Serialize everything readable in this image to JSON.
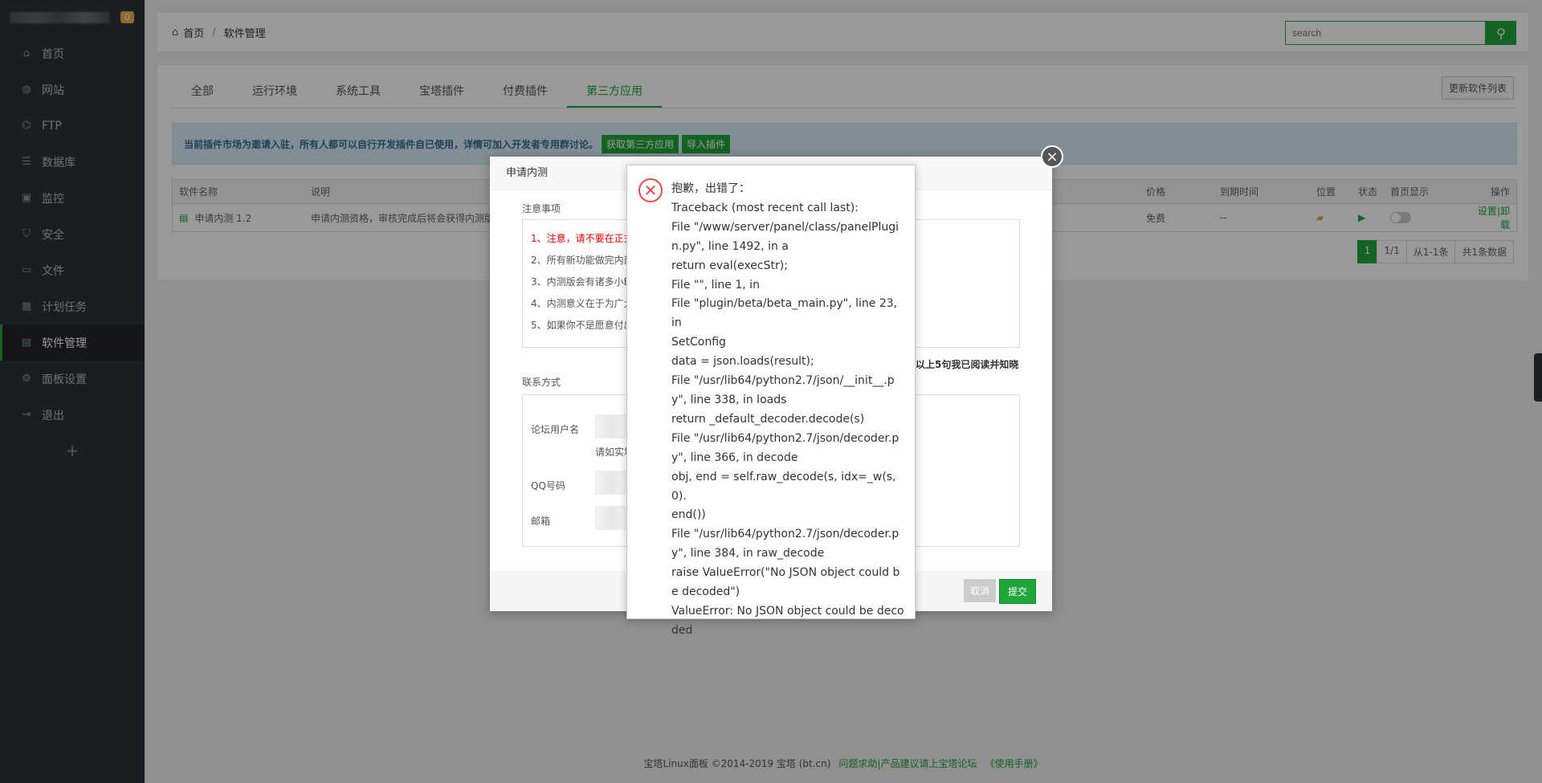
{
  "sidebar": {
    "badge": "0",
    "items": [
      {
        "label": "首页",
        "icon": "home-icon",
        "glyph": "⌂"
      },
      {
        "label": "网站",
        "icon": "globe-icon",
        "glyph": "◍"
      },
      {
        "label": "FTP",
        "icon": "ftp-icon",
        "glyph": "⌬"
      },
      {
        "label": "数据库",
        "icon": "database-icon",
        "glyph": "☰"
      },
      {
        "label": "监控",
        "icon": "monitor-icon",
        "glyph": "▣"
      },
      {
        "label": "安全",
        "icon": "shield-icon",
        "glyph": "⛉"
      },
      {
        "label": "文件",
        "icon": "folder-icon",
        "glyph": "▭"
      },
      {
        "label": "计划任务",
        "icon": "calendar-icon",
        "glyph": "▦"
      },
      {
        "label": "软件管理",
        "icon": "apps-icon",
        "glyph": "▤",
        "active": true
      },
      {
        "label": "面板设置",
        "icon": "gear-icon",
        "glyph": "⚙"
      },
      {
        "label": "退出",
        "icon": "logout-icon",
        "glyph": "⇥"
      }
    ],
    "plus": "+"
  },
  "breadcrumb": {
    "home": "首页",
    "sep": "/",
    "current": "软件管理"
  },
  "search": {
    "placeholder": "search"
  },
  "tabs": [
    "全部",
    "运行环境",
    "系统工具",
    "宝塔插件",
    "付费插件",
    "第三方应用"
  ],
  "update_button": "更新软件列表",
  "notice": {
    "text": "当前插件市场为邀请入驻，所有人都可以自行开发插件自已使用，详情可加入开发者专用群讨论。",
    "btn1": "获取第三方应用",
    "btn2": "导入插件"
  },
  "table": {
    "headers": [
      "软件名称",
      "说明",
      "价格",
      "到期时间",
      "位置",
      "状态",
      "首页显示",
      "操作"
    ],
    "row": {
      "name": "申请内测 1.2",
      "desc": "申请内测资格，审核完成后将会获得内测版",
      "price": "免费",
      "expire": "--",
      "op_set": "设置",
      "op_sep": "|",
      "op_uninstall": "卸载"
    }
  },
  "pager": {
    "page": "1",
    "pages": "1/1",
    "range": "从1-1条",
    "total": "共1条数据"
  },
  "footer": {
    "copyright": "宝塔Linux面板 ©2014-2019 宝塔 (bt.cn)",
    "help": "问题求助|产品建议请上宝塔论坛",
    "manual": "《使用手册》"
  },
  "dialog": {
    "title": "申请内测",
    "notes_label": "注意事项",
    "notes": [
      "1、注意，请不要在正式",
      "2、所有新功能做完内部",
      "3、内测版会有诸多小B",
      "4、内测意义在于为广大",
      "5、如果你不是愿意付出"
    ],
    "read_confirm": "以上5句我已阅读并知晓",
    "contact_label": "联系方式",
    "forum_user": "论坛用户名",
    "hint": "请如实填",
    "qq": "QQ号码",
    "email": "邮箱",
    "cancel": "取消",
    "submit": "提交"
  },
  "error": {
    "lines": [
      "抱歉，出错了：",
      "Traceback (most recent call last):",
      "File \"/www/server/panel/class/panelPlugi",
      "n.py\", line 1492, in a",
      "return eval(execStr);",
      "File \"\", line 1, in",
      "File \"plugin/beta/beta_main.py\", line 23, in",
      "SetConfig",
      "data = json.loads(result);",
      "File \"/usr/lib64/python2.7/json/__init__.p",
      "y\", line 338, in loads",
      "return _default_decoder.decode(s)",
      "File \"/usr/lib64/python2.7/json/decoder.p",
      "y\", line 366, in decode",
      "obj, end = self.raw_decode(s, idx=_w(s, 0).",
      "end())",
      "File \"/usr/lib64/python2.7/json/decoder.p",
      "y\", line 384, in raw_decode",
      "raise ValueError(\"No JSON object could b",
      "e decoded\")",
      "ValueError: No JSON object could be deco",
      "ded"
    ]
  },
  "colors": {
    "accent": "#20a53a",
    "sidebar": "#2c3138",
    "error": "#e94a4a"
  }
}
